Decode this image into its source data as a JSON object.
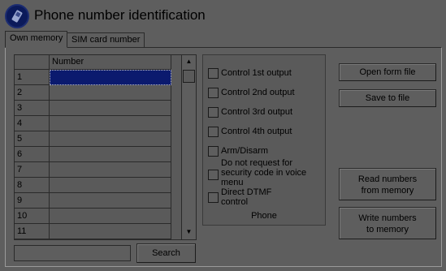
{
  "window": {
    "title": "Phone number identification"
  },
  "tabs": [
    {
      "label": "Own memory",
      "active": true
    },
    {
      "label": "SIM card number",
      "active": false
    }
  ],
  "grid": {
    "column_header": "Number",
    "rows": [
      {
        "index": "1",
        "number": ""
      },
      {
        "index": "2",
        "number": ""
      },
      {
        "index": "3",
        "number": ""
      },
      {
        "index": "4",
        "number": ""
      },
      {
        "index": "5",
        "number": ""
      },
      {
        "index": "6",
        "number": ""
      },
      {
        "index": "7",
        "number": ""
      },
      {
        "index": "8",
        "number": ""
      },
      {
        "index": "9",
        "number": ""
      },
      {
        "index": "10",
        "number": ""
      },
      {
        "index": "11",
        "number": ""
      }
    ],
    "selected_row": 1
  },
  "search": {
    "value": "",
    "button_label": "Search"
  },
  "phone_group": {
    "caption": "Phone",
    "options": [
      {
        "label": "Control 1st output",
        "checked": false
      },
      {
        "label": "Control 2nd output",
        "checked": false
      },
      {
        "label": "Control 3rd output",
        "checked": false
      },
      {
        "label": "Control 4th output",
        "checked": false
      },
      {
        "label": "Arm/Disarm",
        "checked": false
      },
      {
        "label": "Do not request for security code in voice menu",
        "checked": false
      },
      {
        "label": "Direct DTMF control",
        "checked": false
      }
    ]
  },
  "buttons": {
    "open_form_file": "Open form file",
    "save_to_file": "Save to file",
    "read_numbers_line1": "Read numbers",
    "read_numbers_line2": "from memory",
    "write_numbers_line1": "Write numbers",
    "write_numbers_line2": "to memory"
  },
  "colors": {
    "background": "#5e5e5e",
    "selection": "#0b1a6e",
    "icon_circle": "#0b1a5a"
  }
}
